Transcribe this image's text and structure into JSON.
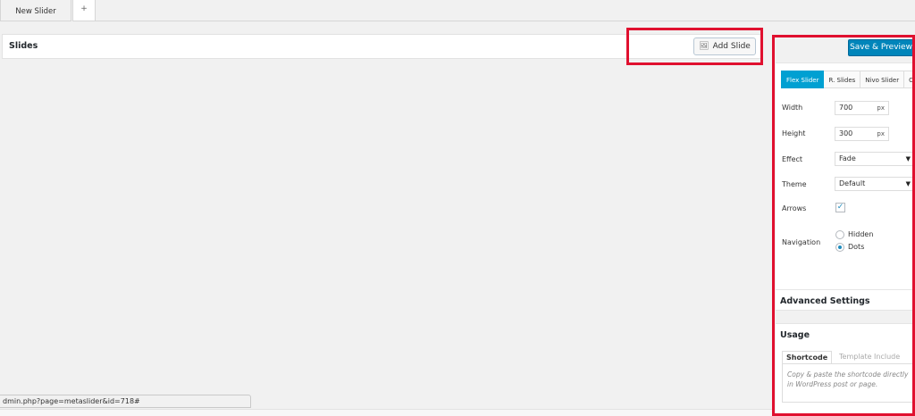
{
  "top_tabs": {
    "active": "New Slider",
    "add": "+"
  },
  "slides": {
    "title": "Slides",
    "add_button": "Add Slide"
  },
  "panel": {
    "save_button": "Save & Preview",
    "slider_tabs": [
      "Flex Slider",
      "R. Slides",
      "Nivo Slider",
      "Co"
    ],
    "width": {
      "label": "Width",
      "value": "700",
      "unit": "px"
    },
    "height": {
      "label": "Height",
      "value": "300",
      "unit": "px"
    },
    "effect": {
      "label": "Effect",
      "value": "Fade"
    },
    "theme": {
      "label": "Theme",
      "value": "Default"
    },
    "arrows": {
      "label": "Arrows",
      "checked": true
    },
    "navigation": {
      "label": "Navigation",
      "options": [
        "Hidden",
        "Dots"
      ],
      "selected": "Dots"
    },
    "advanced_title": "Advanced Settings",
    "usage": {
      "title": "Usage",
      "tabs": [
        "Shortcode",
        "Template Include"
      ],
      "text": "Copy & paste the shortcode directly in WordPress post or page."
    }
  },
  "status_url": "dmin.php?page=metaslider&id=718#",
  "colors": {
    "primary": "#0085ba",
    "active_tab": "#00a0d2",
    "highlight": "#e0102f"
  }
}
